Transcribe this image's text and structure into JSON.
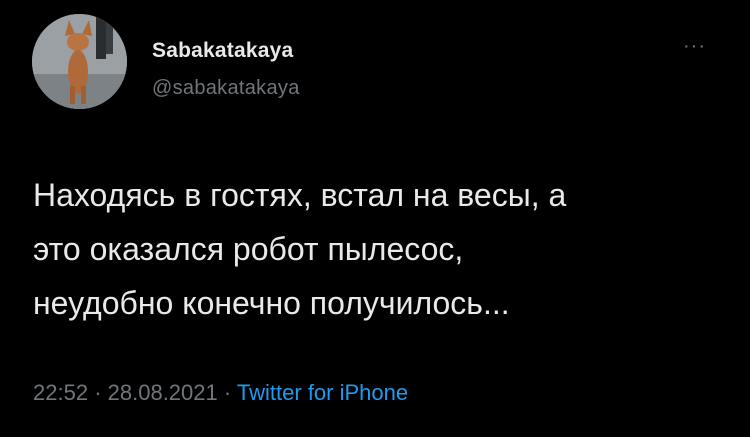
{
  "tweet": {
    "display_name": "Sabakatakaya",
    "handle": "@sabakatakaya",
    "more_icon": "more-horizontal-icon",
    "text": "Находясь в гостях, встал на весы, а\nэто оказался робот пылесос,\nнеудобно конечно получилось...",
    "time": "22:52",
    "separator": "·",
    "date": "28.08.2021",
    "source": "Twitter for iPhone"
  },
  "colors": {
    "background": "#000000",
    "text": "#e7e9ea",
    "secondary": "#71767b",
    "link": "#1d9bf0"
  }
}
